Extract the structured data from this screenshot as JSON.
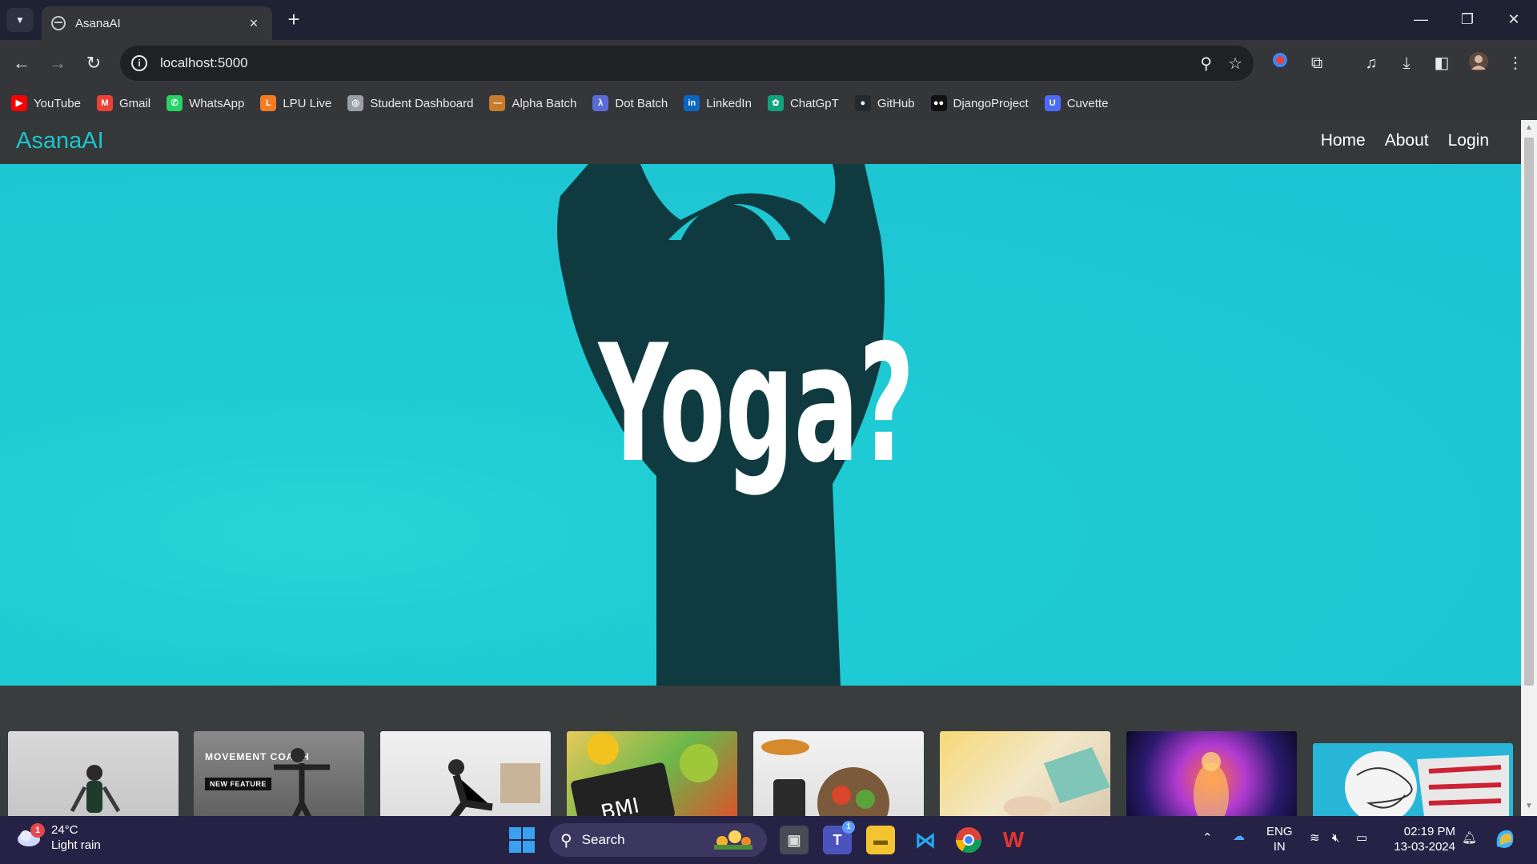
{
  "browser": {
    "tab_title": "AsanaAI",
    "new_tab": "+",
    "close_tab": "×",
    "url": "localhost:5000",
    "window_controls": {
      "minimize": "—",
      "restore": "❐",
      "close": "✕"
    }
  },
  "bookmarks": [
    {
      "label": "YouTube",
      "icon": "youtube-icon",
      "color": "#ff0000",
      "glyph": "▶"
    },
    {
      "label": "Gmail",
      "icon": "gmail-icon",
      "color": "#ea4335",
      "glyph": "M"
    },
    {
      "label": "WhatsApp",
      "icon": "whatsapp-icon",
      "color": "#25d366",
      "glyph": "✆"
    },
    {
      "label": "LPU Live",
      "icon": "lpu-live-icon",
      "color": "#f57c20",
      "glyph": "L"
    },
    {
      "label": "Student Dashboard",
      "icon": "globe-icon",
      "color": "#9aa0a6",
      "glyph": "◎"
    },
    {
      "label": "Alpha Batch",
      "icon": "alpha-batch-icon",
      "color": "#c77b2b",
      "glyph": "—"
    },
    {
      "label": "Dot Batch",
      "icon": "dot-batch-icon",
      "color": "#5b6bd6",
      "glyph": "λ"
    },
    {
      "label": "LinkedIn",
      "icon": "linkedin-icon",
      "color": "#0a66c2",
      "glyph": "in"
    },
    {
      "label": "ChatGpT",
      "icon": "chatgpt-icon",
      "color": "#10a37f",
      "glyph": "✿"
    },
    {
      "label": "GitHub",
      "icon": "github-icon",
      "color": "#24292f",
      "glyph": "●"
    },
    {
      "label": "DjangoProject",
      "icon": "django-icon",
      "color": "#111111",
      "glyph": "●●"
    },
    {
      "label": "Cuvette",
      "icon": "cuvette-icon",
      "color": "#4a6cf7",
      "glyph": "U"
    }
  ],
  "site": {
    "brand": "AsanaAI",
    "nav": {
      "home": "Home",
      "about": "About",
      "login": "Login"
    },
    "hero_text": "Yoga?",
    "thumbnails": [
      {
        "name": "thumb-yoga-woman",
        "label": "",
        "badge": ""
      },
      {
        "name": "thumb-movement-coach",
        "label": "MOVEMENT COACH",
        "badge": "NEW FEATURE"
      },
      {
        "name": "thumb-situps",
        "label": "",
        "badge": ""
      },
      {
        "name": "thumb-bmi",
        "label": "BMI",
        "badge": ""
      },
      {
        "name": "thumb-healthy-food",
        "label": "",
        "badge": ""
      },
      {
        "name": "thumb-meditation-hands",
        "label": "",
        "badge": ""
      },
      {
        "name": "thumb-chakra",
        "label": "",
        "badge": ""
      },
      {
        "name": "thumb-stress",
        "label": "",
        "badge": ""
      }
    ]
  },
  "taskbar": {
    "weather_temp": "24°C",
    "weather_desc": "Light rain",
    "weather_badge": "1",
    "search_label": "Search",
    "teams_badge": "1",
    "lang_line1": "ENG",
    "lang_line2": "IN",
    "time": "02:19 PM",
    "date": "13-03-2024"
  },
  "colors": {
    "brand": "#1ec4cc",
    "hero_bg": "#1dc3d3",
    "silhouette": "#0f3b40"
  }
}
